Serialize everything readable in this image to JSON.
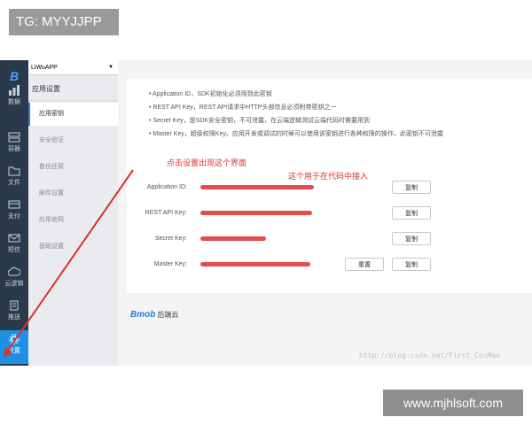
{
  "overlay_tag": "TG: MYYJJPP",
  "rail": {
    "logo": "B",
    "items": [
      {
        "label": "数据",
        "icon": "chart-icon"
      },
      {
        "label": "容器",
        "icon": "server-icon"
      },
      {
        "label": "文件",
        "icon": "folder-icon"
      },
      {
        "label": "支付",
        "icon": "card-icon"
      },
      {
        "label": "短信",
        "icon": "mail-icon"
      },
      {
        "label": "云逻辑",
        "icon": "cloud-icon"
      },
      {
        "label": "推送",
        "icon": "push-icon"
      },
      {
        "label": "设置",
        "icon": "gear-icon"
      }
    ]
  },
  "menu": {
    "app_select": "LiWuAPP",
    "header": "应用设置",
    "items": [
      "应用密钥",
      "安全验证",
      "备份还原",
      "邮件设置",
      "应用官网",
      "基础设置"
    ]
  },
  "bullets": [
    "Application ID，SDK初始化必须用到此密钥",
    "REST API Key，REST API请求中HTTP头部信息必须附带密钥之一",
    "Secret Key，是SDK安全密钥，不可泄露，在云端逻辑测试云端代码时需要用到",
    "Master Key，超级权限Key。应用开发或调试的时候可以使用该密钥进行各种权限的操作，此密钥不可泄露"
  ],
  "annotations": {
    "note1": "点击设置出现这个界面",
    "note2": "这个用于在代码中接入"
  },
  "keys": [
    {
      "label": "Application ID:",
      "copy": "复制"
    },
    {
      "label": "REST API Key:",
      "copy": "复制"
    },
    {
      "label": "Secret Key:",
      "copy": "复制"
    },
    {
      "label": "Master Key:",
      "reset": "重置",
      "copy": "复制"
    }
  ],
  "footer": {
    "brand": "Bmob",
    "suffix": "后端云"
  },
  "watermark_blog": "http://blog.csdn.net/First_CooMan",
  "watermark_site": "www.mjhlsoft.com",
  "colors": {
    "accent": "#1f8fe6",
    "annotation": "#d9312e",
    "rail": "#2b3a4a"
  }
}
